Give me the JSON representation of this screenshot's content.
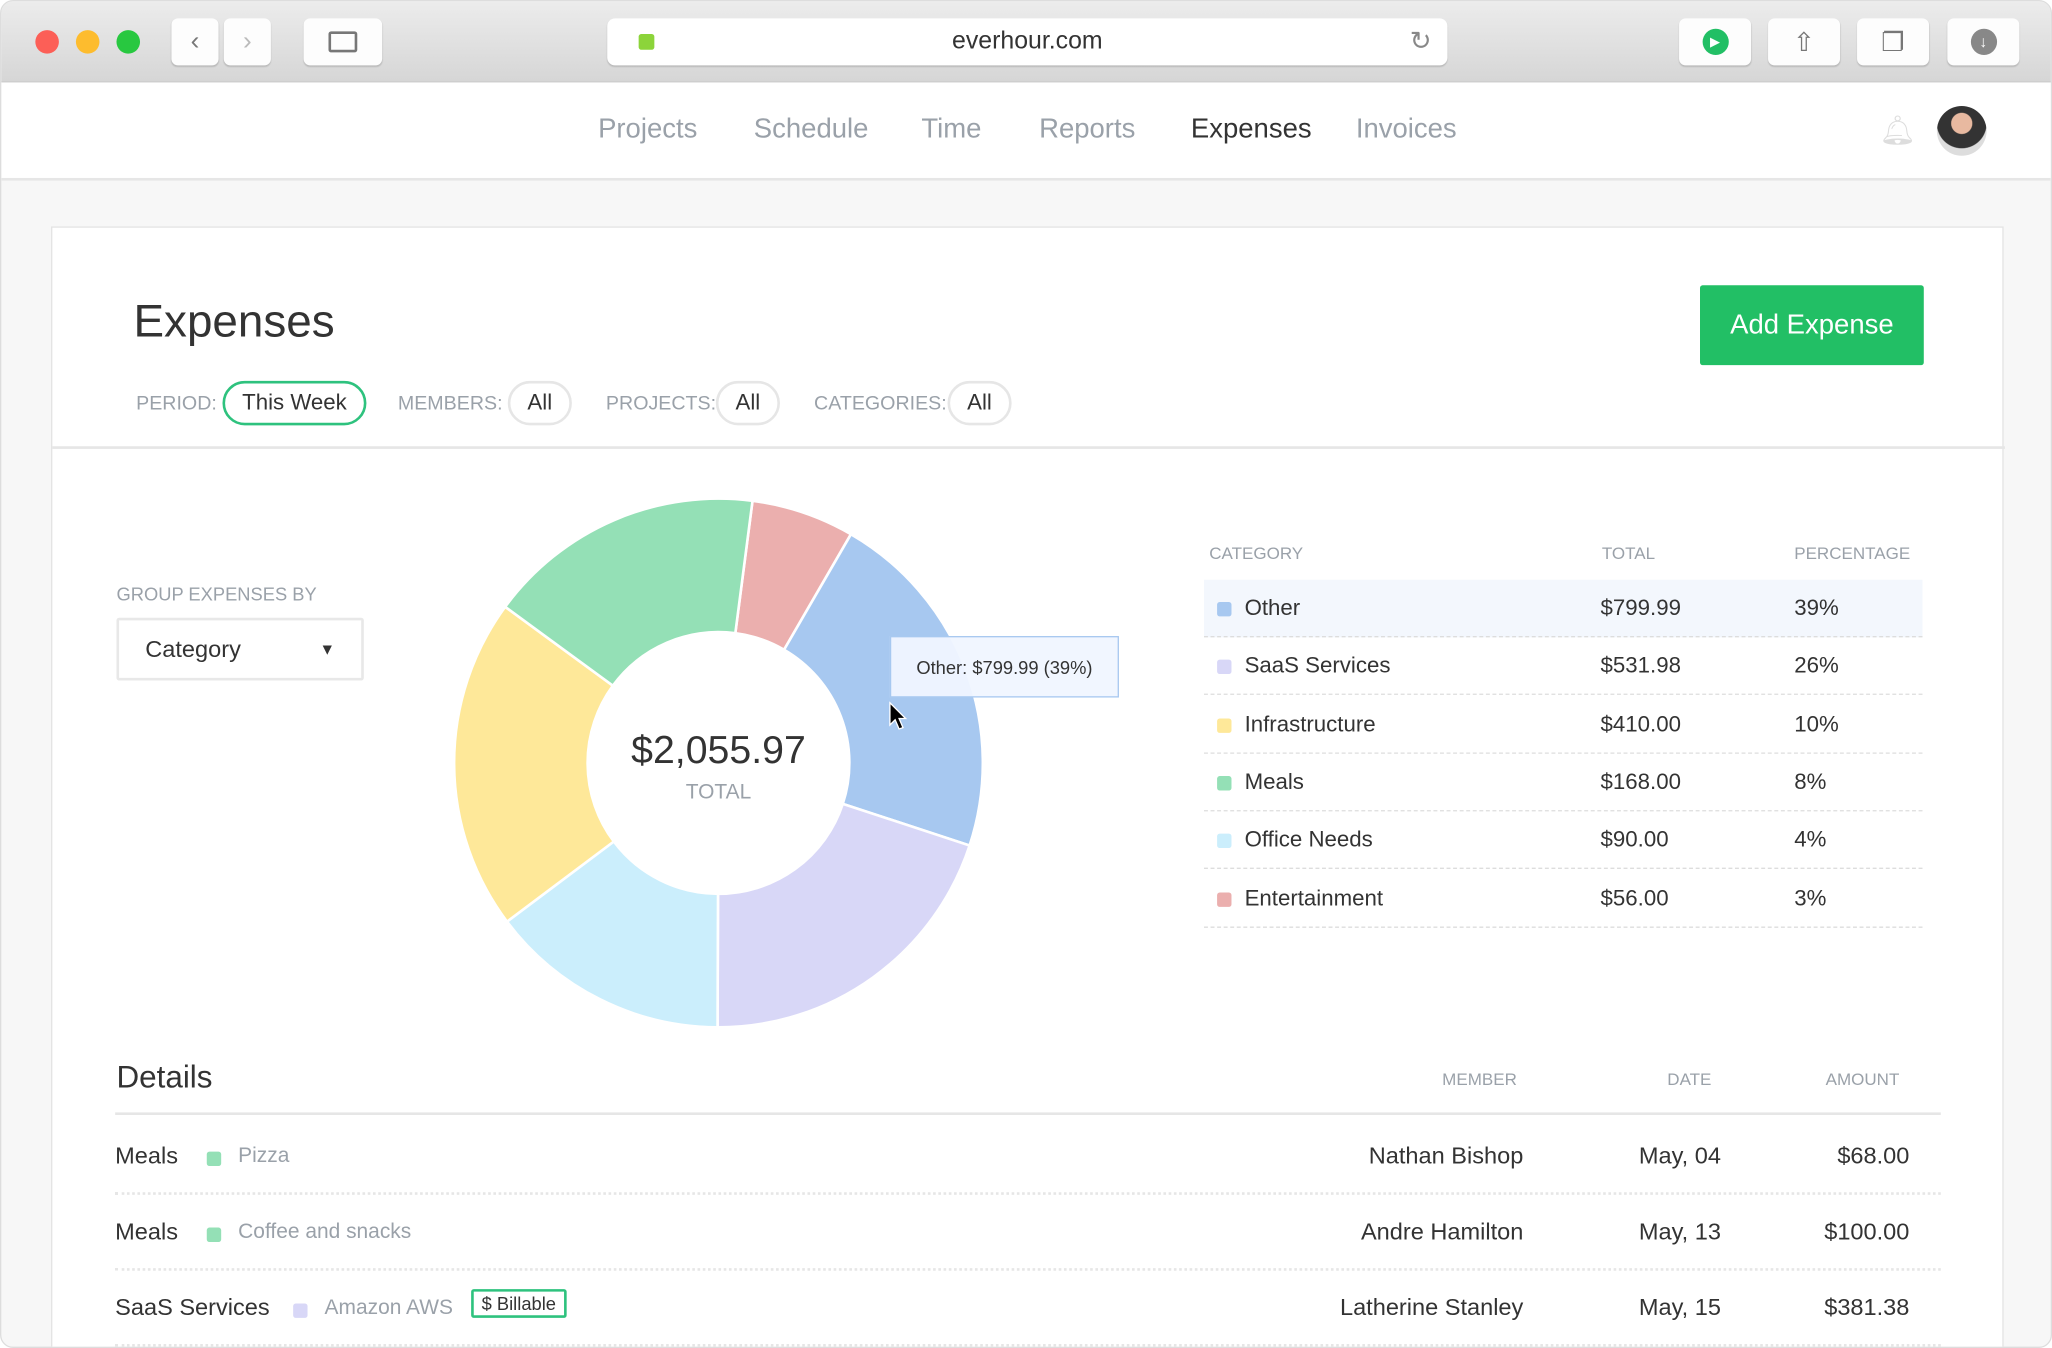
{
  "browser": {
    "url": "everhour.com"
  },
  "nav": {
    "items": [
      "Projects",
      "Schedule",
      "Time",
      "Reports",
      "Expenses",
      "Invoices"
    ],
    "active": "Expenses"
  },
  "page": {
    "title": "Expenses",
    "add_button": "Add Expense"
  },
  "filters": {
    "period_label": "PERIOD:",
    "period_value": "This Week",
    "members_label": "MEMBERS:",
    "members_value": "All",
    "projects_label": "PROJECTS:",
    "projects_value": "All",
    "categories_label": "CATEGORIES:",
    "categories_value": "All"
  },
  "group": {
    "label": "GROUP EXPENSES BY",
    "value": "Category"
  },
  "donut": {
    "total": "$2,055.97",
    "total_label": "TOTAL",
    "tooltip": "Other: $799.99 (39%)"
  },
  "colors": {
    "accent": "#22bf65"
  },
  "summary": {
    "headers": [
      "CATEGORY",
      "TOTAL",
      "PERCENTAGE"
    ],
    "rows": [
      {
        "name": "Other",
        "total": "$799.99",
        "pct": "39%",
        "color": "#a7c8f0"
      },
      {
        "name": "SaaS Services",
        "total": "$531.98",
        "pct": "26%",
        "color": "#d8d7f7"
      },
      {
        "name": "Infrastructure",
        "total": "$410.00",
        "pct": "10%",
        "color": "#fee899"
      },
      {
        "name": "Meals",
        "total": "$168.00",
        "pct": "8%",
        "color": "#94e0b6"
      },
      {
        "name": "Office Needs",
        "total": "$90.00",
        "pct": "4%",
        "color": "#cbeefc"
      },
      {
        "name": "Entertainment",
        "total": "$56.00",
        "pct": "3%",
        "color": "#ebafae"
      }
    ]
  },
  "chart_data": {
    "type": "pie",
    "title": "",
    "start_angle_deg": 7.4,
    "slices": [
      {
        "name": "Entertainment",
        "share": 6.3,
        "color": "#ebafae"
      },
      {
        "name": "Other",
        "share": 21.7,
        "color": "#a7c8f0"
      },
      {
        "name": "SaaS Services",
        "share": 20,
        "color": "#d8d7f7"
      },
      {
        "name": "Office Needs",
        "share": 14.7,
        "color": "#cbeefc"
      },
      {
        "name": "Infrastructure",
        "share": 20.3,
        "color": "#fee899"
      },
      {
        "name": "Meals",
        "share": 17,
        "color": "#94e0b6"
      }
    ]
  },
  "details": {
    "title": "Details",
    "headers": {
      "member": "MEMBER",
      "date": "DATE",
      "amount": "AMOUNT"
    },
    "rows": [
      {
        "category": "Meals",
        "color": "#94e0b6",
        "note": "Pizza",
        "badge": "",
        "member": "Nathan Bishop",
        "date": "May, 04",
        "amount": "$68.00"
      },
      {
        "category": "Meals",
        "color": "#94e0b6",
        "note": "Coffee and snacks",
        "badge": "",
        "member": "Andre Hamilton",
        "date": "May, 13",
        "amount": "$100.00"
      },
      {
        "category": "SaaS Services",
        "color": "#d8d7f7",
        "note": "Amazon AWS",
        "badge": "$ Billable",
        "member": "Latherine Stanley",
        "date": "May, 15",
        "amount": "$381.38"
      }
    ]
  }
}
